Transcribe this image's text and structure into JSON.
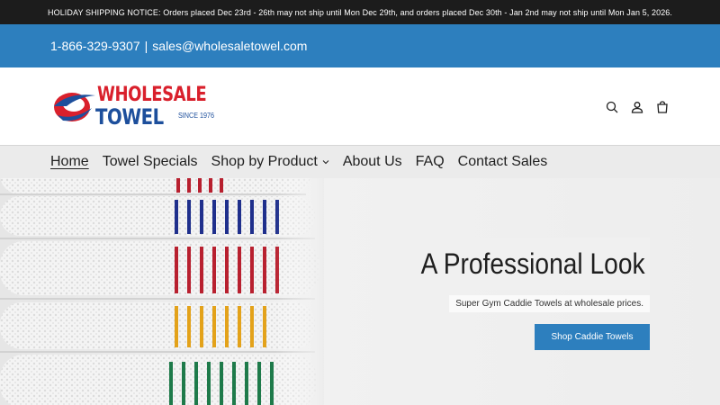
{
  "announcement": {
    "text": "HOLIDAY SHIPPING NOTICE: Orders placed Dec 23rd - 26th may not ship until Mon Dec 29th, and orders placed Dec 30th - Jan 2nd may not ship until Mon Jan 5, 2026."
  },
  "contact": {
    "phone": "1-866-329-9307",
    "separator": "|",
    "email": "sales@wholesaletowel.com"
  },
  "logo": {
    "word1": "WHOLESALE",
    "word2": "TOWEL",
    "since": "SINCE 1976"
  },
  "header_icons": [
    "search-icon",
    "account-icon",
    "cart-icon"
  ],
  "nav": {
    "items": [
      {
        "label": "Home",
        "active": true
      },
      {
        "label": "Towel Specials"
      },
      {
        "label": "Shop by Product",
        "dropdown": true
      },
      {
        "label": "About Us"
      },
      {
        "label": "FAQ"
      },
      {
        "label": "Contact Sales"
      }
    ]
  },
  "hero": {
    "title": "A Professional Look",
    "subtitle": "Super Gym Caddie Towels at wholesale prices.",
    "button_label": "Shop Caddie Towels"
  },
  "colors": {
    "announcement_bg": "#1c1c1c",
    "brand_blue": "#2d7fbe",
    "logo_red": "#d9202c",
    "logo_blue": "#1d4f9c",
    "nav_bg": "#ebebeb"
  }
}
